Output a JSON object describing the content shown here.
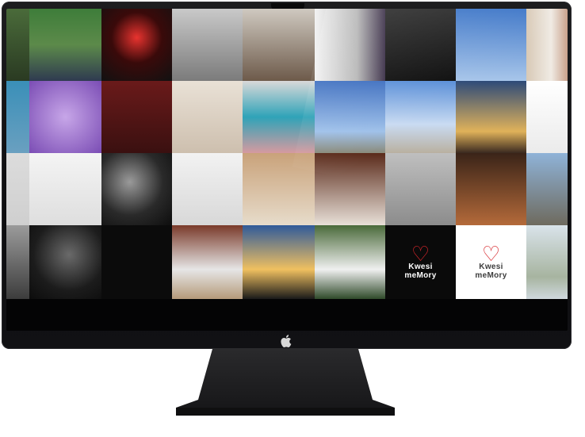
{
  "gallery": {
    "brand_line1": "Kwesi",
    "brand_line2": "meMory",
    "tiles": [
      {
        "name": "tile-portrait-trees",
        "bg": "linear-gradient(#4a6b3a,#2a3a22)"
      },
      {
        "name": "tile-man-sweater",
        "bg": "linear-gradient(#3e7d3a,#5c8a4a 50%,#2f3a50)"
      },
      {
        "name": "tile-red-flower",
        "bg": "radial-gradient(circle at 50% 40%,#e8332f,#3a0a0a 45%,#111)"
      },
      {
        "name": "tile-shoes-grey",
        "bg": "linear-gradient(#c9c9c9,#7b7b7b)"
      },
      {
        "name": "tile-sneaker",
        "bg": "linear-gradient(#cfc9c0,#6d5a4a)"
      },
      {
        "name": "tile-bride-dress",
        "bg": "linear-gradient(90deg,#f2f2f2,#b7b7b7 60%,#3b2f48)"
      },
      {
        "name": "tile-phone",
        "bg": "linear-gradient(#2a2a2a,#0f0f0f)"
      },
      {
        "name": "tile-sky-clouds",
        "bg": "linear-gradient(#3f77c8,#a8c6ea)"
      },
      {
        "name": "tile-groom-couple",
        "bg": "linear-gradient(90deg,#d8c9b6,#f0ebe4 60%,#c9a18b)"
      },
      {
        "name": "tile-bridesmaids-blue",
        "bg": "linear-gradient(#3a8fb8,#6aa0c0)"
      },
      {
        "name": "tile-purple-decor",
        "bg": "radial-gradient(circle,#c7a6e8,#7a4cb4)"
      },
      {
        "name": "tile-bride-steps",
        "bg": "linear-gradient(#6a1a1a,#3a1010)"
      },
      {
        "name": "tile-wedding-gown",
        "bg": "linear-gradient(#e9e1d6,#cdbfae)"
      },
      {
        "name": "tile-bridal-party",
        "bg": "linear-gradient(#d9d9d9,#2fa3b8 50%,#d69aa0)"
      },
      {
        "name": "tile-monument-sky",
        "bg": "linear-gradient(#3e6fc0,#9fc1ea 70%,#8a8a7a)"
      },
      {
        "name": "tile-independence-arch",
        "bg": "linear-gradient(#5a8fd8,#c9dbf2 60%,#b9b0a0)"
      },
      {
        "name": "tile-beach-sunset",
        "bg": "linear-gradient(#2d4a78,#e0b25a 70%,#3a2a20)"
      },
      {
        "name": "tile-nail-polish",
        "bg": "linear-gradient(#ffffff,#ebebeb)"
      },
      {
        "name": "tile-blank-left",
        "bg": "linear-gradient(#dcdcdc,#cfcfcf)"
      },
      {
        "name": "tile-perfume-bottle",
        "bg": "linear-gradient(#f4f4f4,#dedede)"
      },
      {
        "name": "tile-smiling-woman-bw",
        "bg": "radial-gradient(circle at 40% 40%,#9a9a9a,#2a2a2a 55%,#0d0d0d)"
      },
      {
        "name": "tile-sprays-coils",
        "bg": "linear-gradient(#f2f2f2,#d8d8d8)"
      },
      {
        "name": "tile-bride-bath",
        "bg": "linear-gradient(#c9a27a,#e7dccb)"
      },
      {
        "name": "tile-bride-veil",
        "bg": "linear-gradient(#5a2a1a,#e8e0d8)"
      },
      {
        "name": "tile-grey-dress",
        "bg": "linear-gradient(#bfbfbf,#8c8c8c)"
      },
      {
        "name": "tile-corridor-dress",
        "bg": "linear-gradient(#3a2418,#b46a3a)"
      },
      {
        "name": "tile-town-aerial",
        "bg": "linear-gradient(#8fb3d8,#6e6a5e)"
      },
      {
        "name": "tile-child-bw",
        "bg": "linear-gradient(#9b9b9b,#3c3c3c)"
      },
      {
        "name": "tile-woman-bw",
        "bg": "radial-gradient(circle at 55% 40%,#6a6a6a,#1c1c1c 60%,#0c0c0c)"
      },
      {
        "name": "tile-dark-empty",
        "bg": "linear-gradient(#0b0b0b,#0b0b0b)"
      },
      {
        "name": "tile-couple-group",
        "bg": "linear-gradient(#7a3a2a,#e6e6e6 60%,#b59a7a)"
      },
      {
        "name": "tile-sunset-horizon",
        "bg": "linear-gradient(#2f5a9a,#f0c060 60%,#1a1a1a)"
      },
      {
        "name": "tile-bride-garden",
        "bg": "linear-gradient(#4a6a3a,#f0f0f0 60%,#2f4a2a)"
      },
      {
        "name": "tile-logo-dark",
        "bg": "#0a0a0a",
        "logo": "dark"
      },
      {
        "name": "tile-logo-light",
        "bg": "#ffffff",
        "logo": "light"
      },
      {
        "name": "tile-lagoon",
        "bg": "linear-gradient(#d9e3ea,#a7b4a0 70%,#cfd8dd)"
      }
    ]
  }
}
